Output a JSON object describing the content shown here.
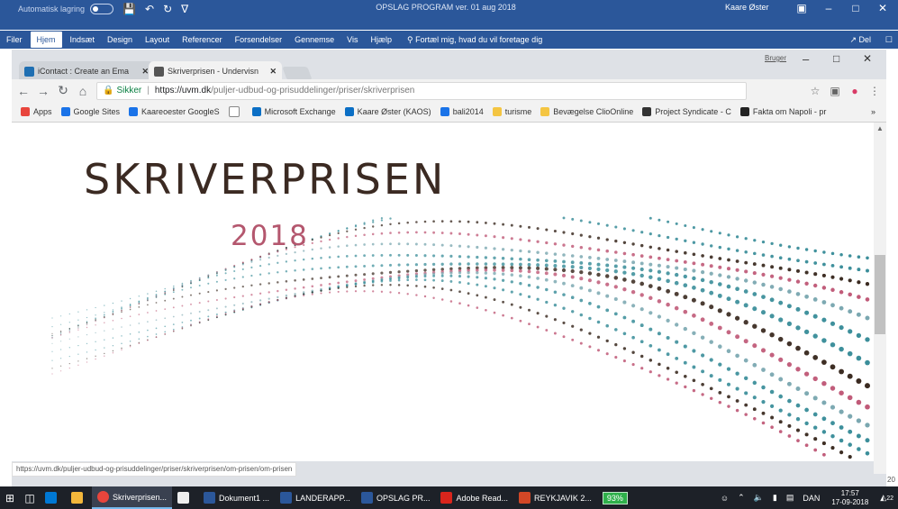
{
  "word": {
    "autosave_label": "Automatisk lagring",
    "title": "OPSLAG PROGRAM ver. 01 aug 2018",
    "user": "Kaare Øster",
    "tabs": [
      "Filer",
      "Hjem",
      "Indsæt",
      "Design",
      "Layout",
      "Referencer",
      "Forsendelser",
      "Gennemse",
      "Vis",
      "Hjælp"
    ],
    "active_tab": "Hjem",
    "tell_me": "Fortæl mig, hvad du vil foretage dig",
    "share": "Del"
  },
  "browser": {
    "tabs": [
      {
        "title": "iContact : Create an Ema",
        "favicon_color": "#1f6fb2"
      },
      {
        "title": "Skriverprisen - Undervisn",
        "favicon_color": "#555555"
      }
    ],
    "user_label": "Bruger",
    "secure_label": "Sikker",
    "url_host": "https://uvm.dk",
    "url_path": "/puljer-udbud-og-prisuddelinger/priser/skriverprisen",
    "bookmarks": [
      {
        "label": "Apps",
        "color": "#e8453c"
      },
      {
        "label": "Google Sites",
        "color": "#1a73e8"
      },
      {
        "label": "Kaareoester GoogleS",
        "color": "#1a73e8"
      },
      {
        "label": "",
        "color": "#888888"
      },
      {
        "label": "Microsoft Exchange",
        "color": "#0b6fc5"
      },
      {
        "label": "Kaare Øster (KAOS)",
        "color": "#0b6fc5"
      },
      {
        "label": "bali2014",
        "color": "#1a73e8"
      },
      {
        "label": "turisme",
        "color": "#f4c542"
      },
      {
        "label": "Bevægelse ClioOnline",
        "color": "#f4c542"
      },
      {
        "label": "Project Syndicate - C",
        "color": "#333333"
      },
      {
        "label": "Fakta om Napoli - pr",
        "color": "#222222"
      }
    ],
    "bookmarks_more": "»",
    "status_url": "https://uvm.dk/puljer-udbud-og-prisuddelinger/priser/skriverprisen/om-prisen/om-prisen"
  },
  "page": {
    "hero_title": "SKRIVERPRISEN",
    "hero_year": "2018"
  },
  "side_number": "20",
  "taskbar": {
    "apps": [
      {
        "label": "",
        "color": "#0078d4"
      },
      {
        "label": "",
        "color": "#f3b73b"
      },
      {
        "label": "Skriverprisen...",
        "color": "#e8453c",
        "active": true
      },
      {
        "label": "",
        "color": "#eeeeee"
      },
      {
        "label": "Dokument1 ...",
        "color": "#2b579a"
      },
      {
        "label": "LANDERAPP...",
        "color": "#2b579a"
      },
      {
        "label": "OPSLAG PR...",
        "color": "#2b579a"
      },
      {
        "label": "Adobe Read...",
        "color": "#d9251c"
      },
      {
        "label": "REYKJAVIK 2...",
        "color": "#d24726"
      }
    ],
    "battery": "93%",
    "language": "DAN",
    "time": "17:57",
    "date": "17-09-2018",
    "notifications": "22"
  },
  "colors": {
    "word_blue": "#2b579a",
    "title_brown": "#3b2a22",
    "year_pink": "#b4576e",
    "wave_teal": "#3b8e9a",
    "wave_pink": "#c05a78",
    "wave_brown": "#3a2a20"
  }
}
